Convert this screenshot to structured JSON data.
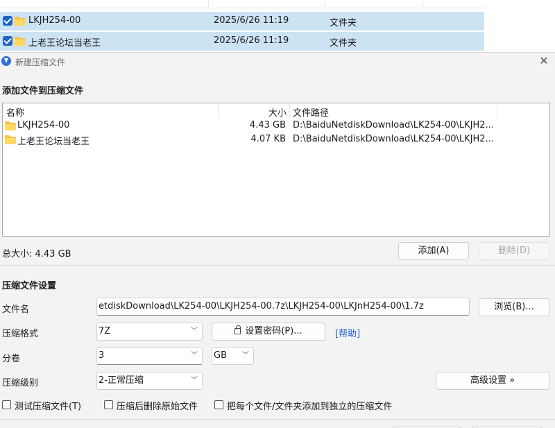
{
  "explorer": {
    "rows": [
      {
        "name": "LKJH254-00",
        "date": "2025/6/26 11:19",
        "type": "文件夹"
      },
      {
        "name": "上老王论坛当老王",
        "date": "2025/6/26 11:19",
        "type": "文件夹"
      }
    ]
  },
  "dialog": {
    "title": "新建压缩文件",
    "close_icon": "close-icon",
    "add_section_title": "添加文件到压缩文件",
    "file_list": {
      "columns": [
        "名称",
        "大小",
        "文件路径"
      ],
      "rows": [
        {
          "name": "LKJH254-00",
          "size": "4.43 GB",
          "path": "D:\\BaiduNetdiskDownload\\LK254-00\\LKJH2..."
        },
        {
          "name": "上老王论坛当老王",
          "size": "4.07 KB",
          "path": "D:\\BaiduNetdiskDownload\\LK254-00\\LKJH2..."
        }
      ]
    },
    "total_size": "总大小: 4.43 GB",
    "add_button": "添加(A)",
    "delete_button": "删除(D)",
    "settings_title": "压缩文件设置",
    "filename_label": "文件名",
    "filename_value": "etdiskDownload\\LK254-00\\LKJH254-00.7z\\LKJH254-00\\LKJnH254-00\\1.7z",
    "browse_button": "浏览(B)...",
    "format_label": "压缩格式",
    "format_value": "7Z",
    "password_button": "设置密码(P)...",
    "help_link": "[帮助]",
    "split_label": "分卷",
    "split_value": "3",
    "split_unit": "GB",
    "level_label": "压缩级别",
    "level_value": "2-正常压缩",
    "advanced_button": "高级设置 »",
    "options": {
      "test": "测试压缩文件(T)",
      "delete_after": "压缩后删除原始文件",
      "separate": "把每个文件/文件夹添加到独立的压缩文件"
    }
  },
  "colors": {
    "accent": "#1e66c5",
    "folder": "#f6c244",
    "link": "#1a5fd1",
    "selection": "#cce3f4"
  }
}
